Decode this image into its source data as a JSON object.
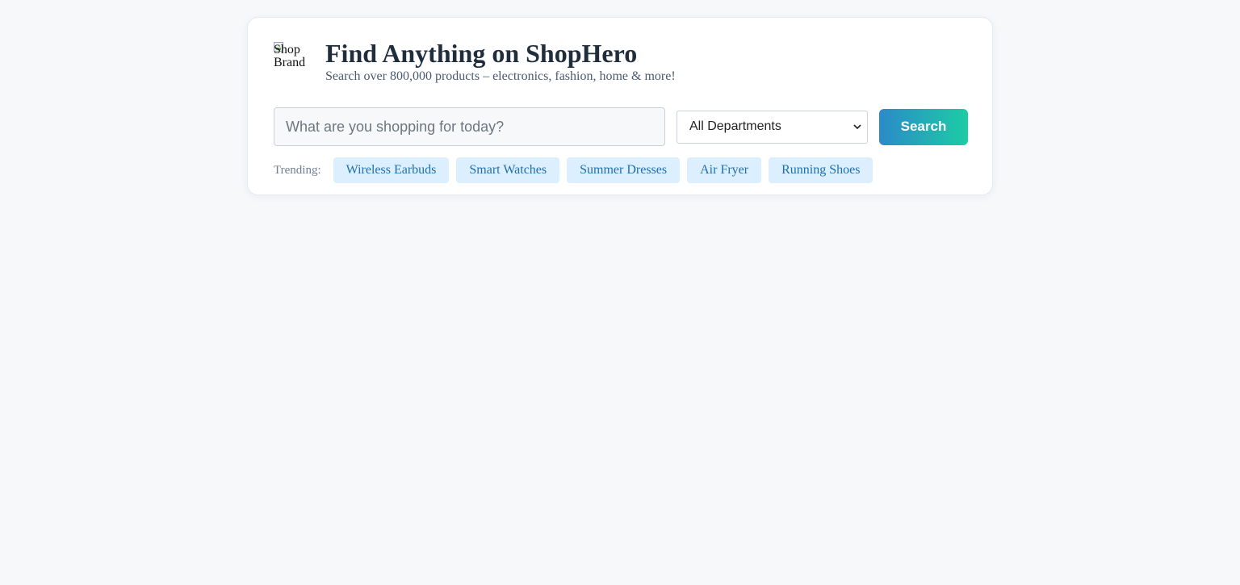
{
  "header": {
    "logo_alt": "Shop\nBrand",
    "title": "Find Anything on ShopHero",
    "subtitle": "Search over 800,000 products – electronics, fashion, home & more!"
  },
  "search": {
    "placeholder": "What are you shopping for today?",
    "value": "",
    "department_selected": "All Departments",
    "button_label": "Search"
  },
  "trending": {
    "label": "Trending:",
    "items": [
      {
        "label": "Wireless Earbuds"
      },
      {
        "label": "Smart Watches"
      },
      {
        "label": "Summer Dresses"
      },
      {
        "label": "Air Fryer"
      },
      {
        "label": "Running Shoes"
      }
    ]
  },
  "colors": {
    "page_background": "#f6f8fa",
    "title": "#1f2d3d",
    "chip_background": "#dcefff",
    "chip_text": "#1f6fad",
    "button_gradient_start": "#2b8ac9",
    "button_gradient_end": "#1dcca4"
  }
}
